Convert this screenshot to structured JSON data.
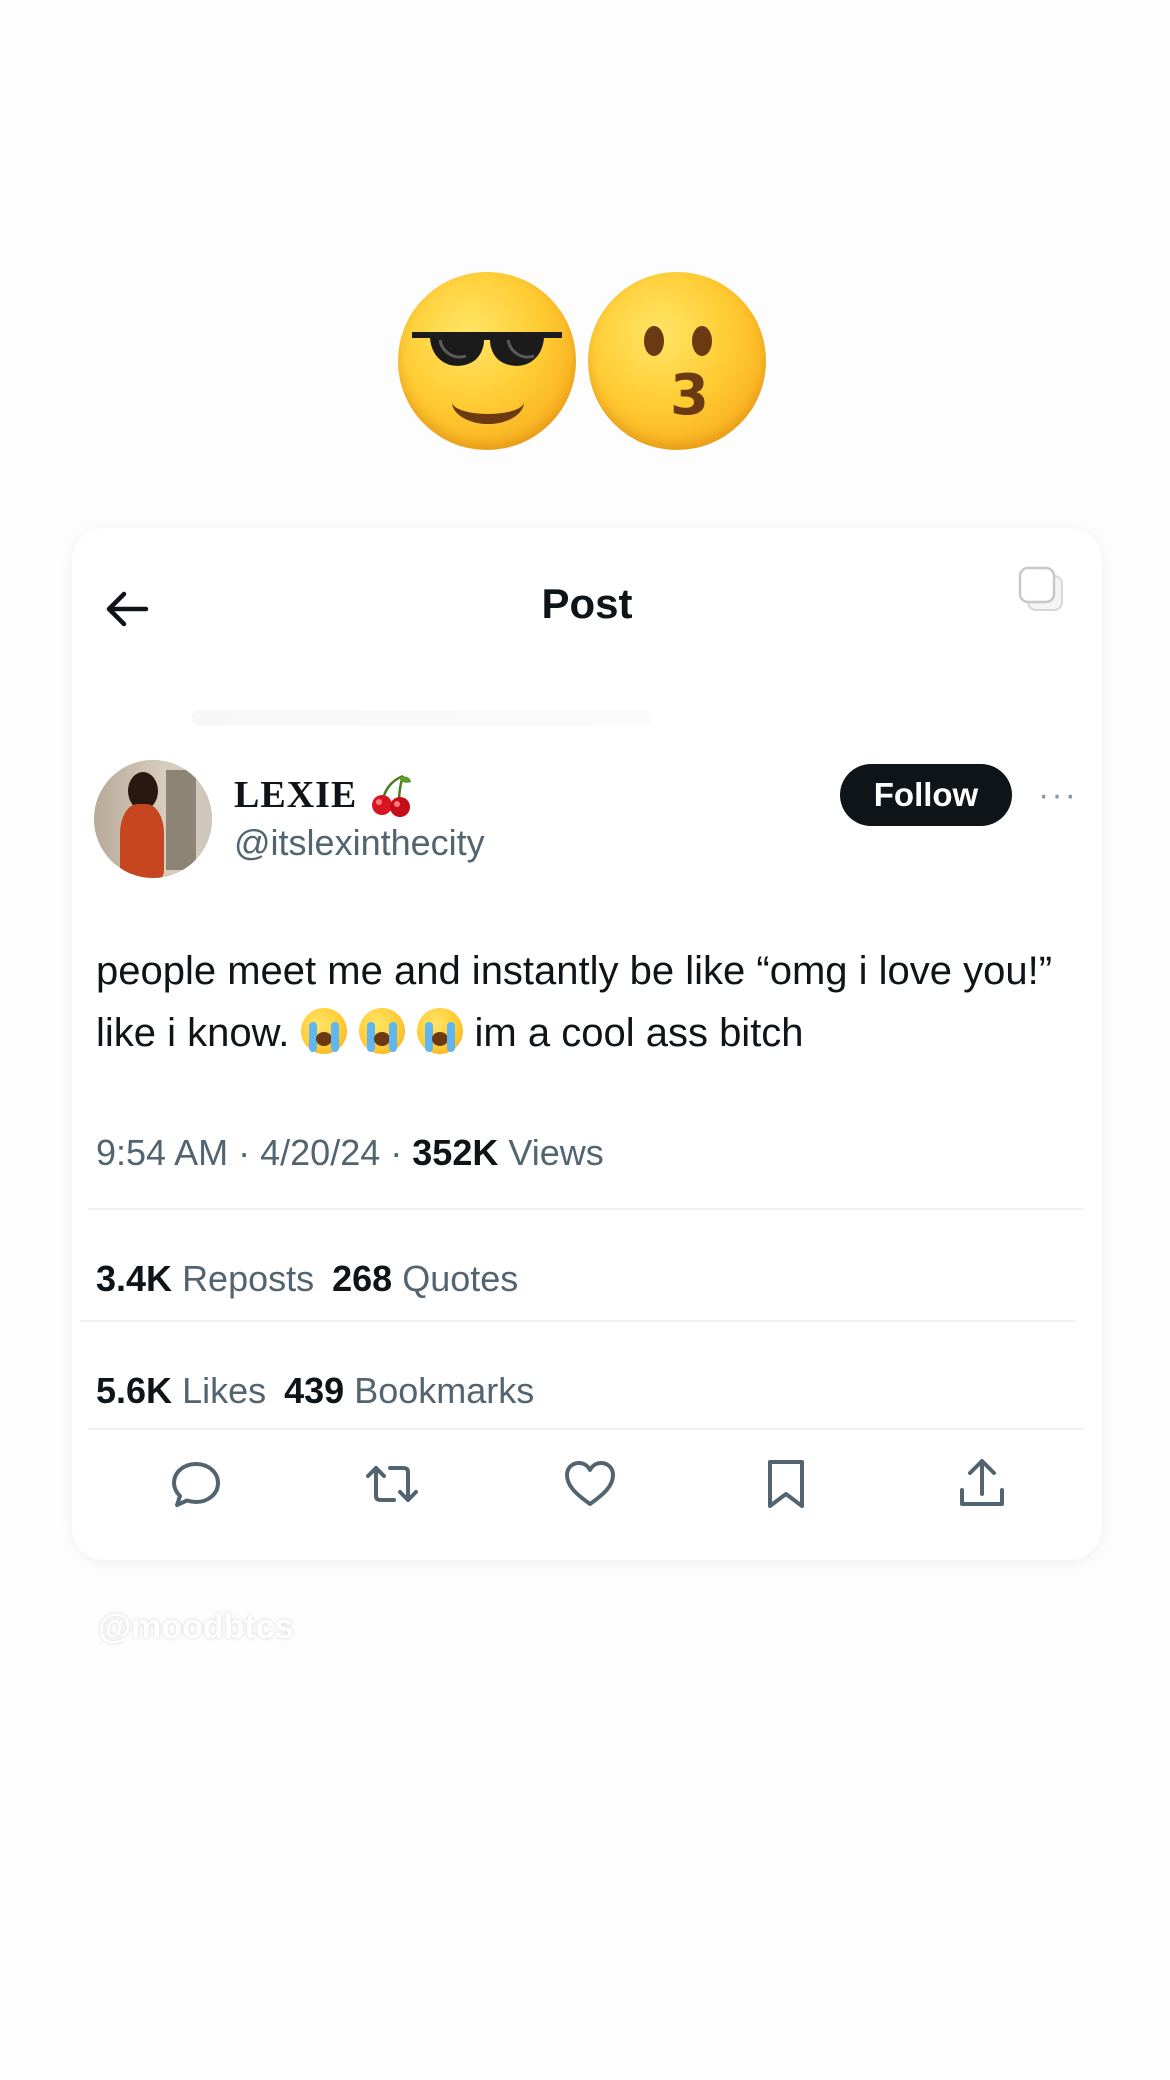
{
  "sticker": {
    "icons": [
      "smiling-face-with-sunglasses-icon",
      "kissing-face-icon"
    ]
  },
  "header": {
    "title": "Post",
    "back_icon": "arrow-left-icon",
    "copy_icon": "copy-icon"
  },
  "author": {
    "name": "LEXIE",
    "name_emoji": "cherries-icon",
    "handle": "@itslexinthecity",
    "follow_label": "Follow",
    "more_icon": "more-horizontal-icon"
  },
  "tweet": {
    "text_part1": "people meet me and instantly be like “omg i love you!” like i know. ",
    "emoji": [
      "loudly-crying-face-icon",
      "loudly-crying-face-icon",
      "loudly-crying-face-icon"
    ],
    "text_part2": "im a cool ass bitch"
  },
  "meta": {
    "time": "9:54 AM",
    "date": "4/20/24",
    "views_count": "352K",
    "views_label": "Views",
    "separator": "·"
  },
  "stats": {
    "reposts_count": "3.4K",
    "reposts_label": "Reposts",
    "quotes_count": "268",
    "quotes_label": "Quotes",
    "likes_count": "5.6K",
    "likes_label": "Likes",
    "bookmarks_count": "439",
    "bookmarks_label": "Bookmarks"
  },
  "actions": [
    "reply-icon",
    "repost-icon",
    "like-icon",
    "bookmark-icon",
    "share-icon"
  ],
  "watermark": "@moodbtcs",
  "colors": {
    "text": "#0f1419",
    "secondary": "#536471",
    "divider": "#eff3f4",
    "follow_bg": "#0f1419",
    "follow_text": "#ffffff"
  }
}
